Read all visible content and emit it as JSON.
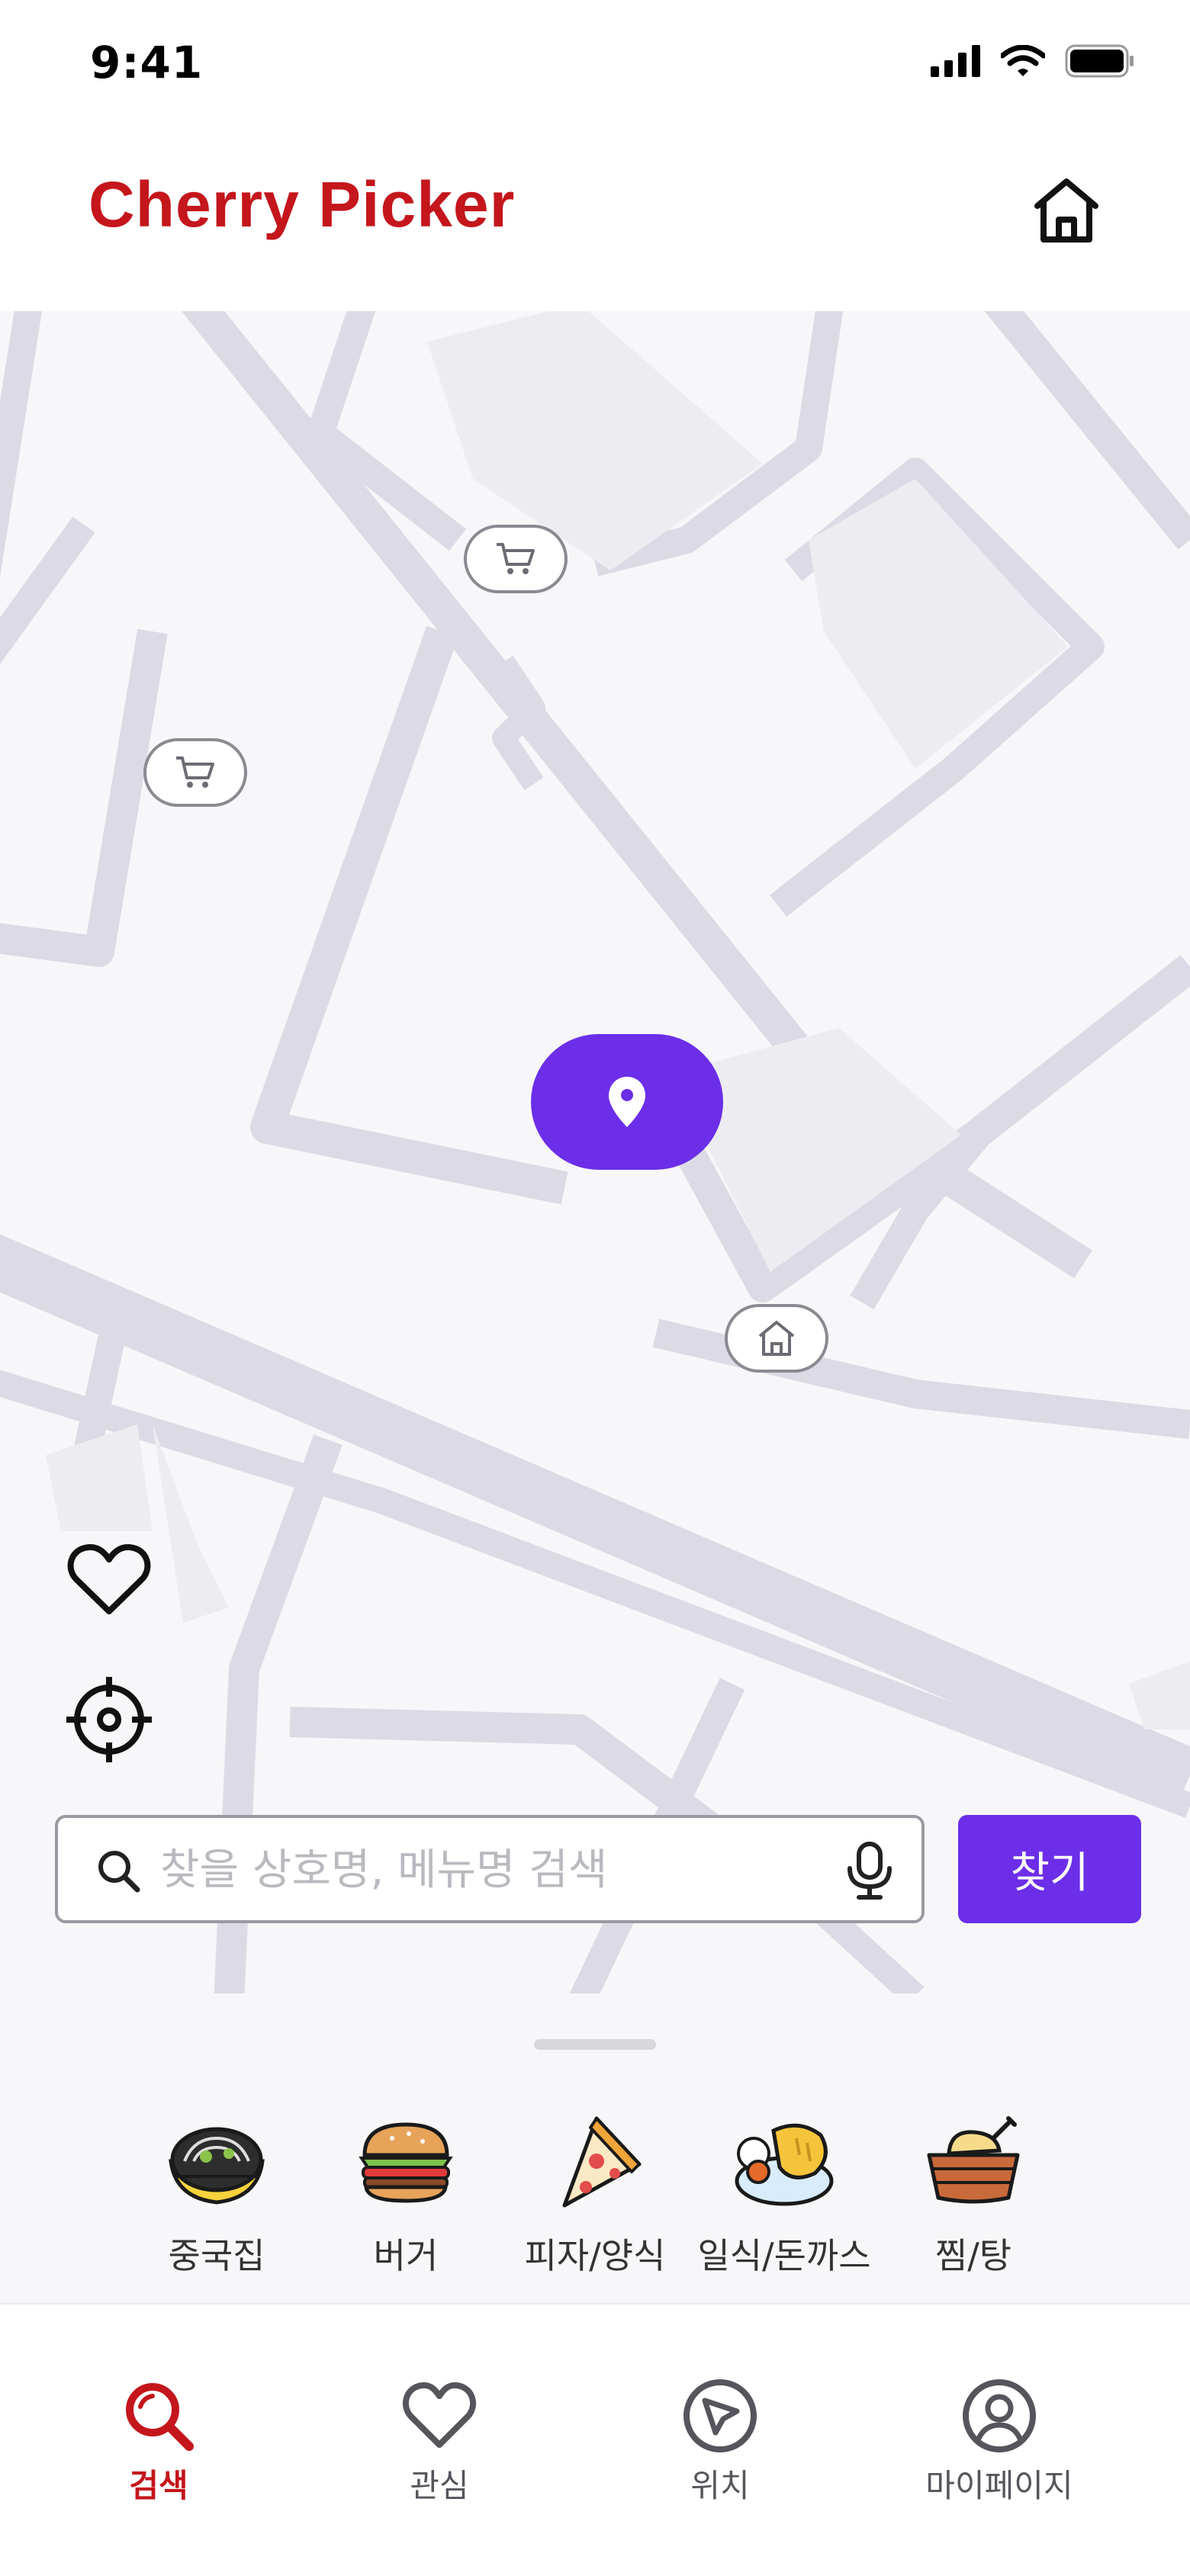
{
  "status_bar": {
    "time": "9:41"
  },
  "header": {
    "title": "Cherry Picker"
  },
  "map": {
    "markers": [
      {
        "type": "cart-icon"
      },
      {
        "type": "cart-icon"
      },
      {
        "type": "home-icon"
      }
    ],
    "current_location": "location-pin-icon"
  },
  "side_buttons": [
    "heart-icon",
    "crosshair-icon"
  ],
  "search": {
    "placeholder": "찾을 상호명, 메뉴명 검색",
    "value": "",
    "button_label": "찾기"
  },
  "categories": [
    {
      "label": "중국집",
      "icon": "noodle-bowl-icon"
    },
    {
      "label": "버거",
      "icon": "burger-icon"
    },
    {
      "label": "피자/양식",
      "icon": "pizza-icon"
    },
    {
      "label": "일식/돈까스",
      "icon": "tonkatsu-icon"
    },
    {
      "label": "찜/탕",
      "icon": "stew-basket-icon"
    }
  ],
  "tabs": [
    {
      "label": "검색",
      "icon": "search-icon",
      "active": true
    },
    {
      "label": "관심",
      "icon": "heart-icon",
      "active": false
    },
    {
      "label": "위치",
      "icon": "navigation-icon",
      "active": false
    },
    {
      "label": "마이페이지",
      "icon": "profile-icon",
      "active": false
    }
  ],
  "colors": {
    "brand": "#c4161c",
    "accent": "#6c2ee8",
    "road": "#dcdbe5",
    "map_bg": "#f7f7f9"
  }
}
